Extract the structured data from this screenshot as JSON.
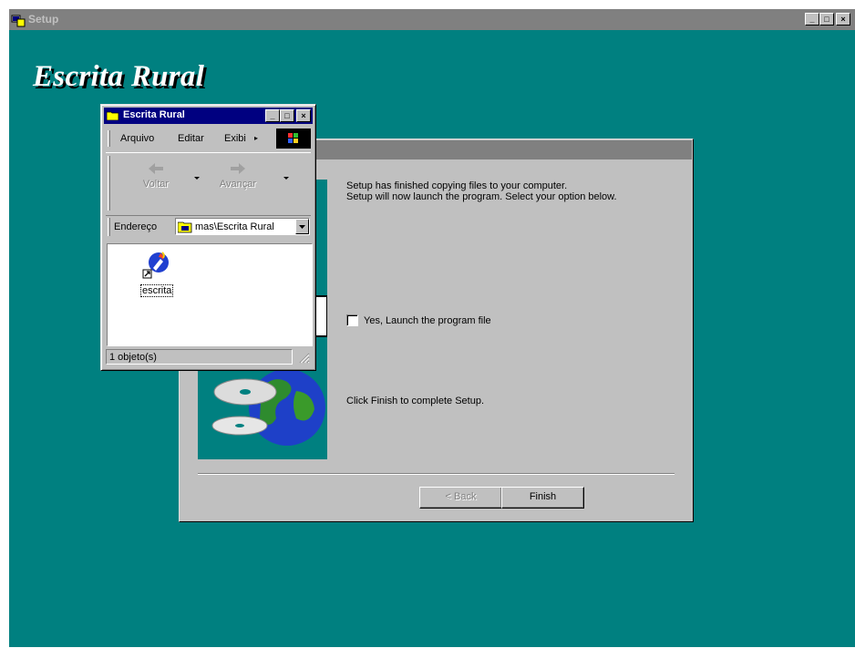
{
  "setup_window": {
    "title": "Setup",
    "heading": "Escrita Rural",
    "controls": {
      "minimize": "_",
      "maximize": "□",
      "close": "×"
    }
  },
  "wizard": {
    "line1": "Setup has finished copying files to your computer.",
    "line2": "Setup will now launch the program. Select your option below.",
    "checkbox_label": "Yes, Launch the program file",
    "checkbox_checked": false,
    "finish_text": "Click Finish to complete Setup.",
    "back_button": "< Back",
    "back_enabled": false,
    "finish_button": "Finish"
  },
  "explorer": {
    "title": "Escrita Rural",
    "menu": [
      "Arquivo",
      "Editar",
      "Exibi"
    ],
    "toolbar": {
      "back": "Voltar",
      "forward": "Avançar"
    },
    "address_label": "Endereço",
    "address_value": "mas\\Escrita Rural",
    "files": [
      {
        "name": "escrita",
        "icon": "shortcut-app-icon"
      }
    ],
    "status": "1 objeto(s)"
  },
  "colors": {
    "desktop": "#008080",
    "titlebar_active": "#000080",
    "titlebar_inactive": "#808080",
    "face": "#c0c0c0"
  }
}
